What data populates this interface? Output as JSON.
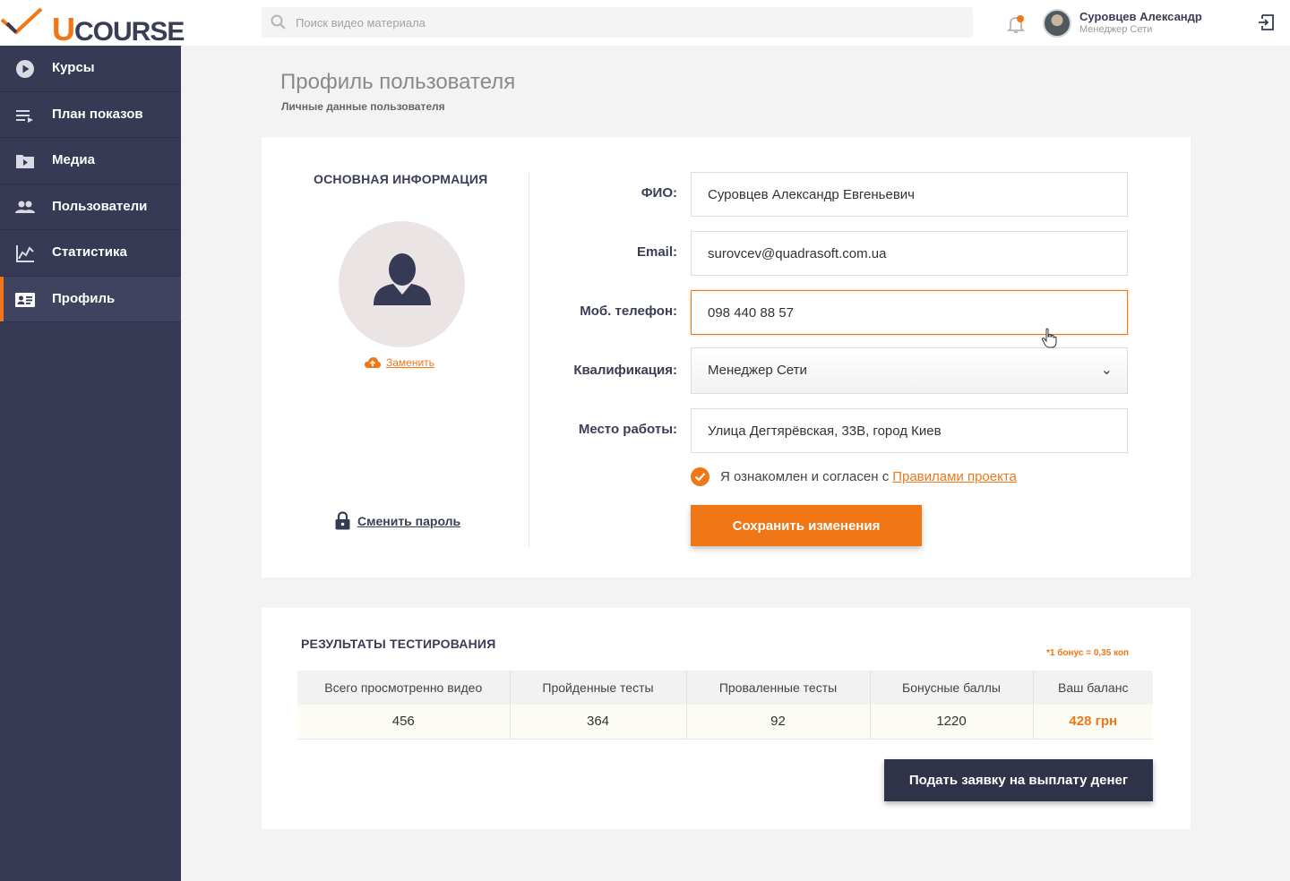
{
  "brand": {
    "logo_u": "U",
    "logo_rest": "COURSE",
    "accent": "#f07616",
    "dark": "#363a54"
  },
  "header": {
    "search_placeholder": "Поиск видео материала",
    "user_name": "Суровцев Александр",
    "user_role": "Менеджер Сети"
  },
  "sidebar": {
    "items": [
      {
        "label": "Курсы",
        "icon": "play-circle-icon"
      },
      {
        "label": "План показов",
        "icon": "playlist-icon"
      },
      {
        "label": "Медиа",
        "icon": "media-folder-icon"
      },
      {
        "label": "Пользователи",
        "icon": "users-icon"
      },
      {
        "label": "Статистика",
        "icon": "chart-icon"
      },
      {
        "label": "Профиль",
        "icon": "profile-card-icon",
        "active": true
      }
    ]
  },
  "page": {
    "title": "Профиль пользователя",
    "subtitle": "Личные данные пользователя"
  },
  "profile": {
    "section_title": "ОСНОВНАЯ ИНФОРМАЦИЯ",
    "replace_label": "Заменить",
    "change_password_label": "Сменить пароль",
    "fields": {
      "fio_label": "ФИО:",
      "fio_value": "Суровцев Александр Евгеньевич",
      "email_label": "Email:",
      "email_value": "surovcev@quadrasoft.com.ua",
      "phone_label": "Моб. телефон:",
      "phone_value": "098 440 88 57",
      "qual_label": "Квалификация:",
      "qual_value": "Менеджер Сети",
      "work_label": "Место работы:",
      "work_value": "Улица Дегтярёвская, 33В, город Киев"
    },
    "agree_text": "Я ознакомлен и согласен с",
    "agree_link": "Правилами проекта",
    "save_label": "Сохранить изменения"
  },
  "results": {
    "section_title": "РЕЗУЛЬТАТЫ ТЕСТИРОВАНИЯ",
    "bonus_note": "*1 бонус = 0,35 коп",
    "columns": [
      "Всего просмотренно видео",
      "Пройденные тесты",
      "Проваленные тесты",
      "Бонусные баллы",
      "Ваш баланс"
    ],
    "values": [
      "456",
      "364",
      "92",
      "1220",
      "428 грн"
    ],
    "payout_label": "Подать заявку на выплату денег"
  }
}
